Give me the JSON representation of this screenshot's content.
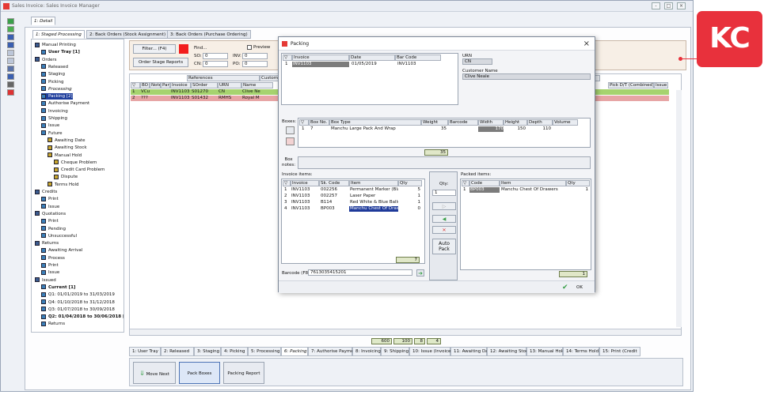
{
  "app": {
    "title": "Sales Invoice: Sales Invoice Manager",
    "controls": [
      "-",
      "□",
      "×"
    ]
  },
  "top_tabs": [
    {
      "label": "1: Detail",
      "active": true
    }
  ],
  "sub_tabs": [
    {
      "label": "1: Staged Processing",
      "active": true
    },
    {
      "label": "2: Back Orders (Stock Assignment)",
      "active": false
    },
    {
      "label": "3: Back Orders (Purchase Ordering)",
      "active": false
    }
  ],
  "tree": [
    {
      "label": "Manual Printing",
      "level": 0,
      "style": ""
    },
    {
      "label": "User Tray [1]",
      "level": 1,
      "style": "b"
    },
    {
      "label": "Orders",
      "level": 0,
      "style": ""
    },
    {
      "label": "Released",
      "level": 1,
      "style": ""
    },
    {
      "label": "Staging",
      "level": 1,
      "style": ""
    },
    {
      "label": "Picking",
      "level": 1,
      "style": ""
    },
    {
      "label": "Processing",
      "level": 1,
      "style": "i"
    },
    {
      "label": "Packing [2]",
      "level": 1,
      "style": "sel"
    },
    {
      "label": "Authorise Payment",
      "level": 1,
      "style": ""
    },
    {
      "label": "Invoicing",
      "level": 1,
      "style": ""
    },
    {
      "label": "Shipping",
      "level": 1,
      "style": ""
    },
    {
      "label": "Issue",
      "level": 1,
      "style": ""
    },
    {
      "label": "Future",
      "level": 1,
      "style": ""
    },
    {
      "label": "Awaiting Date",
      "level": 2,
      "style": ""
    },
    {
      "label": "Awaiting Stock",
      "level": 2,
      "style": ""
    },
    {
      "label": "Manual Hold",
      "level": 2,
      "style": ""
    },
    {
      "label": "Cheque Problem",
      "level": 3,
      "style": ""
    },
    {
      "label": "Credit Card Problem",
      "level": 3,
      "style": ""
    },
    {
      "label": "Dispute",
      "level": 3,
      "style": ""
    },
    {
      "label": "Terms Hold",
      "level": 2,
      "style": ""
    },
    {
      "label": "Credits",
      "level": 0,
      "style": ""
    },
    {
      "label": "Print",
      "level": 1,
      "style": ""
    },
    {
      "label": "Issue",
      "level": 1,
      "style": ""
    },
    {
      "label": "Quotations",
      "level": 0,
      "style": ""
    },
    {
      "label": "Print",
      "level": 1,
      "style": ""
    },
    {
      "label": "Pending",
      "level": 1,
      "style": ""
    },
    {
      "label": "Unsuccessful",
      "level": 1,
      "style": ""
    },
    {
      "label": "Returns",
      "level": 0,
      "style": ""
    },
    {
      "label": "Awaiting Arrival",
      "level": 1,
      "style": ""
    },
    {
      "label": "Process",
      "level": 1,
      "style": ""
    },
    {
      "label": "Print",
      "level": 1,
      "style": ""
    },
    {
      "label": "Issue",
      "level": 1,
      "style": ""
    },
    {
      "label": "Issued",
      "level": 0,
      "style": ""
    },
    {
      "label": "Current [1]",
      "level": 1,
      "style": "b"
    },
    {
      "label": "Q1: 01/01/2019 to 31/03/2019",
      "level": 1,
      "style": ""
    },
    {
      "label": "Q4: 01/10/2018 to 31/12/2018",
      "level": 1,
      "style": ""
    },
    {
      "label": "Q3: 01/07/2018 to 30/09/2018",
      "level": 1,
      "style": ""
    },
    {
      "label": "Q2: 01/04/2018 to 30/06/2018 [1]",
      "level": 1,
      "style": "b"
    },
    {
      "label": "Returns",
      "level": 1,
      "style": ""
    }
  ],
  "filter": {
    "filter_label": "Filter... (F4)",
    "order_stage_label": "Order Stage Reports",
    "find_label": "Find...",
    "so_label": "SO:",
    "so_value": "0",
    "inv_label": "INV:",
    "inv_value": "0",
    "cn_label": "CN:",
    "cn_value": "0",
    "po_label": "PO:",
    "po_value": "0",
    "preview_label": "Preview"
  },
  "main_grid": {
    "group_headers": [
      "References",
      "Customer"
    ],
    "headers": [
      "▽",
      "BO",
      "Note",
      "Part",
      "Invoice",
      "SOrder",
      "URN",
      "Name"
    ],
    "right_headers": [
      "Pick D/T (Combined)",
      "Issue"
    ],
    "rows": [
      {
        "num": "1",
        "flag": "VCu",
        "invoice": "INV1103",
        "sorder": "S01270",
        "urn": "CN",
        "name": "Clive Ne",
        "color": "#a6d36f"
      },
      {
        "num": "2",
        "flag": "???",
        "invoice": "INV1103",
        "sorder": "S01432",
        "urn": "RMHS",
        "name": "Royal M",
        "color": "#e7a5a5"
      }
    ]
  },
  "totals": [
    "600",
    "100",
    "8",
    "4"
  ],
  "bottom_tabs": [
    "1: User Tray",
    "2: Released",
    "3: Staging",
    "4: Picking",
    "5: Processing",
    "6: Packing",
    "7: Authorise Payment",
    "8: Invoicing",
    "9: Shipping",
    "10: Issue (Invoices)",
    "11: Awaiting Date",
    "12: Awaiting Stock",
    "13: Manual Hold",
    "14: Terms Hold",
    "15: Print (Credit"
  ],
  "actions": {
    "move_next": "Move Next",
    "pack_boxes": "Pack Boxes",
    "packing_report": "Packing Report"
  },
  "dialog": {
    "title": "Packing",
    "close": "×",
    "order_headers": [
      "▽",
      "Invoice",
      "Date",
      "Bar Code"
    ],
    "order_row": {
      "num": "1",
      "invoice": "INV1103",
      "date": "01/05/2019",
      "barcode": "INV1103"
    },
    "urn_label": "URN",
    "urn_value": "CN",
    "customer_label": "Customer Name",
    "customer_value": "Clive Neale",
    "boxes_label": "Boxes:",
    "box_headers": [
      "▽",
      "Box No.",
      "Box Type",
      "Weight",
      "Barcode",
      "Width",
      "Height",
      "Depth",
      "Volume"
    ],
    "box_row": {
      "num": "1",
      "box_no": "7",
      "box_type": "Manchu Large Pack And Wrap",
      "weight": "35",
      "barcode": "",
      "width": "170",
      "height": "150",
      "depth": "110",
      "volume": ""
    },
    "box_total": "35",
    "box_notes_label": "Box\nnotes:",
    "invoice_items_label": "Invoice items:",
    "inv_headers": [
      "▽",
      "Invoice",
      "Sk. Code",
      "Item",
      "Qty"
    ],
    "inv_rows": [
      {
        "num": "1",
        "invoice": "INV1103",
        "code": "002256",
        "item": "Permanent Marker (Blac",
        "qty": "5"
      },
      {
        "num": "2",
        "invoice": "INV1103",
        "code": "002257",
        "item": "Laser Paper",
        "qty": "1"
      },
      {
        "num": "3",
        "invoice": "INV1103",
        "code": "B114",
        "item": "Red White & Blue Balloo",
        "qty": "1"
      },
      {
        "num": "4",
        "invoice": "INV1103",
        "code": "BP003",
        "item": "Manchu Chest Of Drawe",
        "qty": "0"
      }
    ],
    "inv_total": "7",
    "qty_label": "Qty:",
    "qty_value": "1",
    "auto_pack": "Auto\nPack",
    "packed_items_label": "Packed items:",
    "packed_headers": [
      "▽",
      "Code",
      "Item",
      "Qty"
    ],
    "packed_rows": [
      {
        "num": "1",
        "code": "BP003",
        "item": "Manchu Chest Of Drawers",
        "qty": "1"
      }
    ],
    "packed_total": "1",
    "barcode_label": "Barcode (F8):",
    "barcode_value": "7613035415201",
    "ok_label": "OK"
  },
  "logo": {
    "text": "KC",
    "color": "#e8313c"
  }
}
